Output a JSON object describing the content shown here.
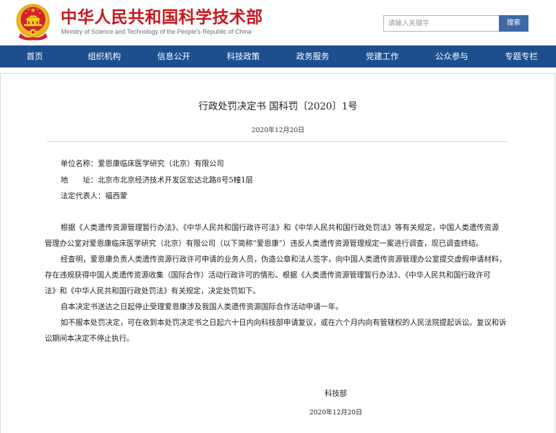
{
  "header": {
    "site_title": "中华人民共和国科学技术部",
    "site_subtitle": "Ministry of Science and Technology of the People's Republic of China",
    "emblem_icon": "national-emblem-icon",
    "search": {
      "placeholder": "请输入关键字",
      "value": "",
      "button_label": "搜索"
    }
  },
  "nav": {
    "items": [
      "首页",
      "组织机构",
      "信息公开",
      "科技政策",
      "政务服务",
      "党建工作",
      "公众参与",
      "专题专栏"
    ]
  },
  "document": {
    "title": "行政处罚决定书 国科罚〔2020〕1号",
    "date": "2020年12月20日",
    "fields": [
      {
        "label": "单位名称：",
        "value": "爱恩康临床医学研究（北京）有限公司"
      },
      {
        "label": "地　　址：",
        "value": "北京市北京经济技术开发区宏达北路8号5幢1层"
      },
      {
        "label": "法定代表人：",
        "value": "福西蒙"
      }
    ],
    "paragraphs": [
      {
        "lines": [
          "根据《人类遗传资源管理暂行办法》、《中华人民共和国行政许可法》和《中华人民共和国行政处罚法》等有关规定，中国人类遗传资源",
          "管理办公室对爱恩康临床医学研究（北京）有限公司（以下简称“爱恩康”）违反人类遗传资源管理规定一案进行调查，现已调查终结。"
        ]
      },
      {
        "lines": [
          "经查明，爱恩康负责人类遗传资源行政许可申请的业务人员，伪造公章和法人签字，向中国人类遗传资源管理办公室提交虚假申请材料，",
          "存在违规获得中国人类遗传资源收集（国际合作）活动行政许可的情形。根据《人类遗传资源管理暂行办法》、《中华人民共和国行政许可",
          "法》和《中华人民共和国行政处罚法》有关规定，决定处罚如下。"
        ]
      },
      {
        "lines": [
          "自本决定书送达之日起停止受理爱恩康涉及我国人类遗传资源国际合作活动申请一年。"
        ]
      },
      {
        "lines": [
          "如不服本处罚决定，可在收到本处罚决定书之日起六十日内向科技部申请复议，或在六个月内向有管辖权的人民法院提起诉讼。复议和诉",
          "讼期间本决定不停止执行。"
        ]
      }
    ],
    "signature": {
      "issuer": "科技部",
      "date": "2020年12月20日"
    }
  },
  "colors": {
    "brand_red": "#c9161d",
    "nav_blue": "#1d4f8f",
    "button_blue": "#3d6aa6",
    "text_dark": "#222222"
  }
}
